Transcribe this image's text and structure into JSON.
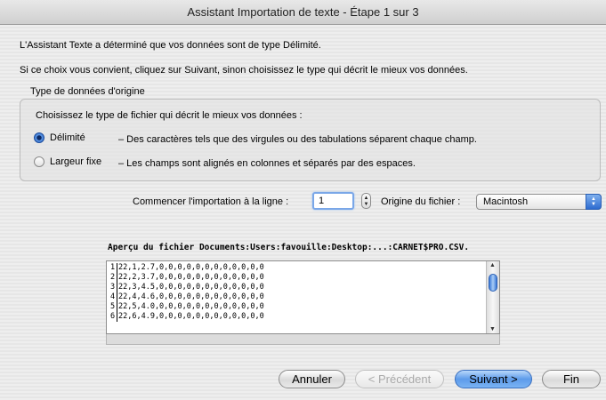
{
  "window": {
    "title": "Assistant Importation de texte - Étape 1 sur 3"
  },
  "intro": {
    "line1": "L'Assistant Texte a déterminé que vos données sont de type Délimité.",
    "line2": "Si ce choix vous convient, cliquez sur Suivant, sinon choisissez le type qui décrit le mieux vos données."
  },
  "data_type": {
    "group_title": "Type de données d'origine",
    "prompt": "Choisissez le type de fichier qui décrit le mieux vos données :",
    "options": [
      {
        "label": "Délimité",
        "description": "– Des caractères tels que des virgules ou des tabulations séparent chaque champ.",
        "selected": true
      },
      {
        "label": "Largeur fixe",
        "description": "– Les champs sont alignés en colonnes et séparés par des espaces.",
        "selected": false
      }
    ]
  },
  "import_settings": {
    "start_row_label": "Commencer l'importation à la ligne :",
    "start_row_value": "1",
    "origin_label": "Origine du fichier :",
    "origin_value": "Macintosh"
  },
  "preview": {
    "label": "Aperçu du fichier Documents:Users:favouille:Desktop:...:CARNET$PRO.CSV.",
    "rows": [
      {
        "num": "1",
        "text": "22,1,2.7,0,0,0,0,0,0,0,0,0,0,0,0"
      },
      {
        "num": "2",
        "text": "22,2,3.7,0,0,0,0,0,0,0,0,0,0,0,0"
      },
      {
        "num": "3",
        "text": "22,3,4.5,0,0,0,0,0,0,0,0,0,0,0,0"
      },
      {
        "num": "4",
        "text": "22,4,4.6,0,0,0,0,0,0,0,0,0,0,0,0"
      },
      {
        "num": "5",
        "text": "22,5,4.0,0,0,0,0,0,0,0,0,0,0,0,0"
      },
      {
        "num": "6",
        "text": "22,6,4.9,0,0,0,0,0,0,0,0,0,0,0,0"
      }
    ]
  },
  "buttons": {
    "cancel": "Annuler",
    "previous": "< Précédent",
    "next": "Suivant >",
    "finish": "Fin"
  },
  "colors": {
    "accent": "#3d7ad8",
    "default_button": "#5d9bea"
  }
}
